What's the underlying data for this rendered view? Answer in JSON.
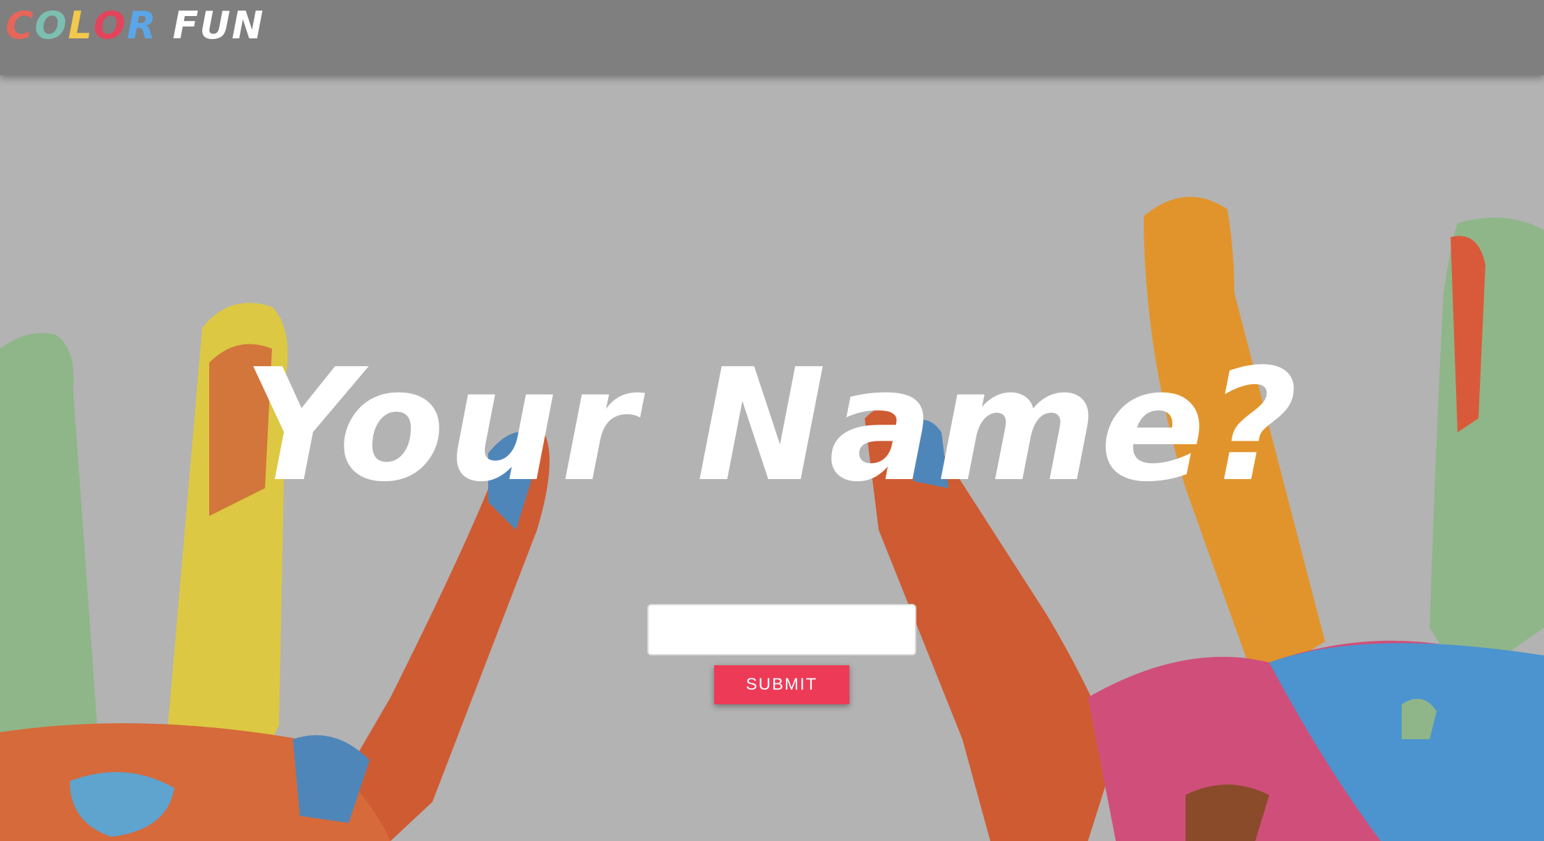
{
  "header": {
    "logo": {
      "letters": [
        {
          "char": "C",
          "color": "#e8655a"
        },
        {
          "char": "O",
          "color": "#7cbfb0"
        },
        {
          "char": "L",
          "color": "#f2c94c"
        },
        {
          "char": "O",
          "color": "#e2445c"
        },
        {
          "char": "R",
          "color": "#5aa6e8"
        }
      ],
      "second_word": "FUN",
      "second_word_color": "#ffffff"
    },
    "bar_color": "#7f7f7f"
  },
  "hero": {
    "headline": "Your Name?",
    "background": "painted-hands-photo"
  },
  "form": {
    "name_input_value": "",
    "name_input_placeholder": "",
    "submit_label": "SUBMIT",
    "submit_color": "#ed3b57"
  }
}
